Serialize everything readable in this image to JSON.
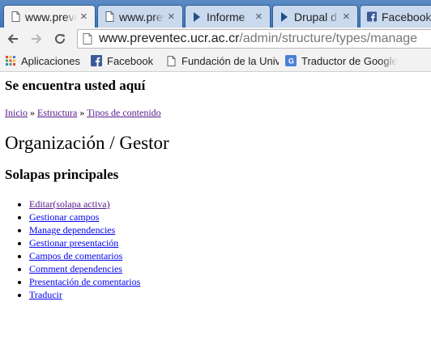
{
  "browser": {
    "tabs": [
      {
        "title": "www.preventec.ucr.ac.cr",
        "icon": "page-icon",
        "active": true
      },
      {
        "title": "www.preventec.ucr.ac.cr",
        "icon": "page-icon",
        "active": false
      },
      {
        "title": "Informe",
        "icon": "drupal-play-icon",
        "active": false
      },
      {
        "title": "Drupal d",
        "icon": "drupal-play-icon",
        "active": false
      },
      {
        "title": "Facebook",
        "icon": "facebook-icon",
        "active": false
      }
    ],
    "url_host": "www.preventec.ucr.ac.cr",
    "url_path": "/admin/structure/types/manage",
    "bookmarks": [
      {
        "label": "Aplicaciones",
        "icon": "apps-grid-icon"
      },
      {
        "label": "Facebook",
        "icon": "facebook-icon"
      },
      {
        "label": "Fundación de la Universidad",
        "icon": "page-icon"
      },
      {
        "label": "Traductor de Google",
        "icon": "google-translate-icon"
      }
    ],
    "colors": {
      "facebook": "#3b5998",
      "tabstrip": "#3f75b5"
    }
  },
  "page": {
    "here_heading": "Se encuentra usted aquí",
    "breadcrumb": [
      {
        "label": "Inicio"
      },
      {
        "label": "Estructura"
      },
      {
        "label": "Tipos de contenido"
      }
    ],
    "breadcrumb_separator": "»",
    "title": "Organización / Gestor",
    "tabs_heading": "Solapas principales",
    "tab_links": [
      {
        "label": "Editar(solapa activa)",
        "visited": true
      },
      {
        "label": "Gestionar campos",
        "visited": false
      },
      {
        "label": "Manage dependencies",
        "visited": false
      },
      {
        "label": "Gestionar presentación",
        "visited": false
      },
      {
        "label": "Campos de comentarios",
        "visited": false
      },
      {
        "label": "Comment dependencies",
        "visited": false
      },
      {
        "label": "Presentación de comentarios",
        "visited": false
      },
      {
        "label": "Traducir",
        "visited": false
      }
    ]
  }
}
